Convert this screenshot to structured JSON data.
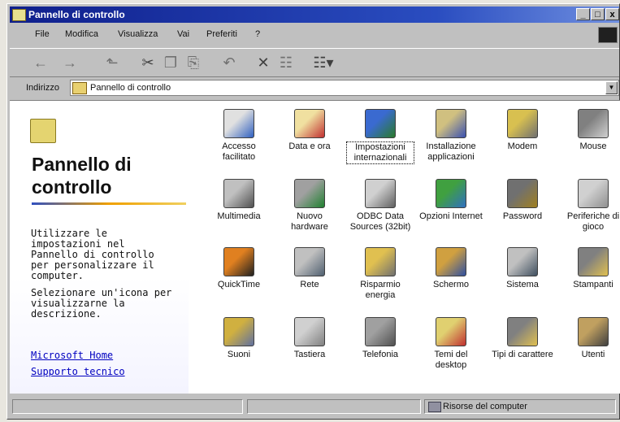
{
  "window": {
    "title": "Pannello di controllo",
    "buttons": [
      "_",
      "□",
      "x"
    ]
  },
  "menu": [
    "File",
    "Modifica",
    "Visualizza",
    "Vai",
    "Preferiti",
    "?"
  ],
  "address": {
    "label": "Indirizzo",
    "value": "Pannello di controllo"
  },
  "left_panel": {
    "title": "Pannello di controllo",
    "description1": "Utilizzare le impostazioni nel Pannello di controllo per personalizzare il computer.",
    "description2": "Selezionare un'icona per visualizzarne la descrizione.",
    "link1": "Microsoft Home",
    "link2": "Supporto tecnico"
  },
  "items": [
    {
      "label": "Accesso facilitato",
      "icon": "accessibility-icon"
    },
    {
      "label": "Data e ora",
      "icon": "calendar-clock-icon"
    },
    {
      "label": "Impostazioni internazionali",
      "icon": "globe-icon",
      "selected": true
    },
    {
      "label": "Installazione applicazioni",
      "icon": "install-apps-icon"
    },
    {
      "label": "Modem",
      "icon": "modem-phone-icon"
    },
    {
      "label": "Mouse",
      "icon": "mouse-icon"
    },
    {
      "label": "Multimedia",
      "icon": "multimedia-icon"
    },
    {
      "label": "Nuovo hardware",
      "icon": "new-hardware-icon"
    },
    {
      "label": "ODBC Data Sources (32bit)",
      "icon": "odbc-icon"
    },
    {
      "label": "Opzioni Internet",
      "icon": "internet-options-icon"
    },
    {
      "label": "Password",
      "icon": "keys-icon"
    },
    {
      "label": "Periferiche di gioco",
      "icon": "joystick-icon"
    },
    {
      "label": "QuickTime",
      "icon": "quicktime-icon"
    },
    {
      "label": "Rete",
      "icon": "network-icon"
    },
    {
      "label": "Risparmio energia",
      "icon": "power-saving-icon"
    },
    {
      "label": "Schermo",
      "icon": "display-icon"
    },
    {
      "label": "Sistema",
      "icon": "computer-icon"
    },
    {
      "label": "Stampanti",
      "icon": "printers-folder-icon"
    },
    {
      "label": "Suoni",
      "icon": "speaker-icon"
    },
    {
      "label": "Tastiera",
      "icon": "keyboard-icon"
    },
    {
      "label": "Telefonia",
      "icon": "telephony-icon"
    },
    {
      "label": "Temi del desktop",
      "icon": "themes-icon"
    },
    {
      "label": "Tipi di carattere",
      "icon": "fonts-folder-icon"
    },
    {
      "label": "Utenti",
      "icon": "users-icon"
    }
  ],
  "status": {
    "zone": "Risorse del computer"
  }
}
